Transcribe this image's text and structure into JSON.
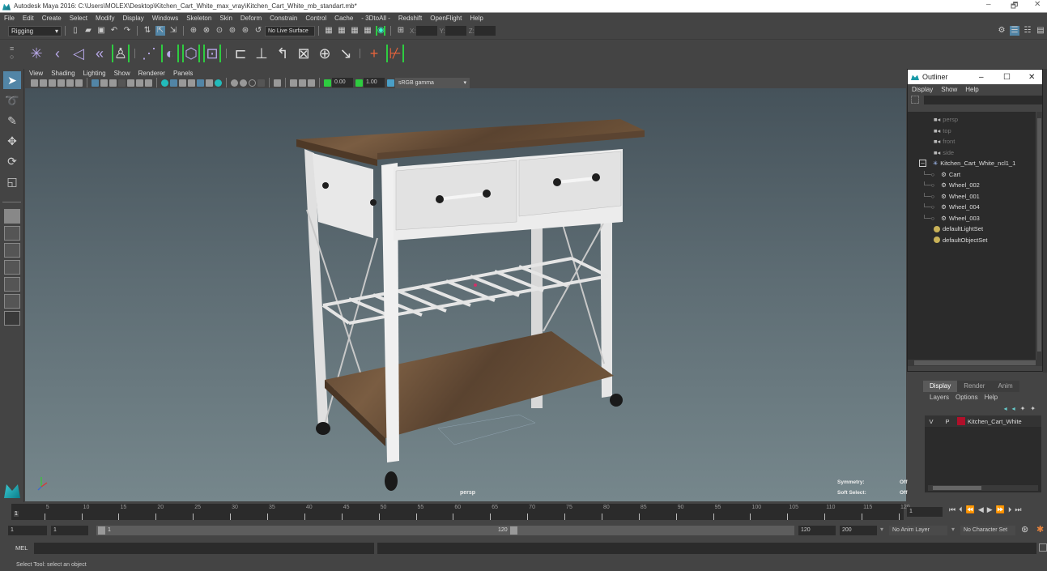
{
  "window": {
    "title": "Autodesk Maya 2016: C:\\Users\\MOLEX\\Desktop\\Kitchen_Cart_White_max_vray\\Kitchen_Cart_White_mb_standart.mb*",
    "minimize": "–",
    "maximize": "🗗",
    "close": "✕"
  },
  "menubar": [
    "File",
    "Edit",
    "Create",
    "Select",
    "Modify",
    "Display",
    "Windows",
    "Skeleton",
    "Skin",
    "Deform",
    "Constrain",
    "Control",
    "Cache",
    "- 3DtoAll -",
    "Redshift",
    "OpenFlight",
    "Help"
  ],
  "status_line": {
    "menu_set": "Rigging",
    "live_surface": "No Live Surface",
    "x_label": "X:",
    "y_label": "Y:",
    "z_label": "Z:",
    "x_value": "",
    "y_value": "",
    "z_value": ""
  },
  "viewport": {
    "menu": [
      "View",
      "Shading",
      "Lighting",
      "Show",
      "Renderer",
      "Panels"
    ],
    "exposure": "0.00",
    "gamma": "1.00",
    "color_space": "sRGB gamma",
    "camera_label": "persp",
    "symmetry_label": "Symmetry:",
    "symmetry_value": "Off",
    "soft_select_label": "Soft Select:",
    "soft_select_value": "Off"
  },
  "outliner": {
    "title": "Outliner",
    "menu": [
      "Display",
      "Show",
      "Help"
    ],
    "items": [
      {
        "label": "persp",
        "type": "camera",
        "indent": 0,
        "dim": true
      },
      {
        "label": "top",
        "type": "camera",
        "indent": 0,
        "dim": true
      },
      {
        "label": "front",
        "type": "camera",
        "indent": 0,
        "dim": true
      },
      {
        "label": "side",
        "type": "camera",
        "indent": 0,
        "dim": true
      },
      {
        "label": "Kitchen_Cart_White_ncl1_1",
        "type": "group",
        "indent": 0,
        "dim": false,
        "expanded": true
      },
      {
        "label": "Cart",
        "type": "mesh",
        "indent": 1,
        "dim": false
      },
      {
        "label": "Wheel_002",
        "type": "mesh",
        "indent": 1,
        "dim": false
      },
      {
        "label": "Wheel_001",
        "type": "mesh",
        "indent": 1,
        "dim": false
      },
      {
        "label": "Wheel_004",
        "type": "mesh",
        "indent": 1,
        "dim": false
      },
      {
        "label": "Wheel_003",
        "type": "mesh",
        "indent": 1,
        "dim": false
      },
      {
        "label": "defaultLightSet",
        "type": "set",
        "indent": 0,
        "dim": false
      },
      {
        "label": "defaultObjectSet",
        "type": "set",
        "indent": 0,
        "dim": false
      }
    ]
  },
  "layer_editor": {
    "tabs": [
      "Display",
      "Render",
      "Anim"
    ],
    "active_tab": "Display",
    "menu": [
      "Layers",
      "Options",
      "Help"
    ],
    "layers": [
      {
        "visible": "V",
        "playback": "P",
        "color": "#b0102a",
        "name": "Kitchen_Cart_White"
      }
    ]
  },
  "timeline": {
    "ticks": [
      "5",
      "10",
      "15",
      "20",
      "25",
      "30",
      "35",
      "40",
      "45",
      "50",
      "55",
      "60",
      "65",
      "70",
      "75",
      "80",
      "85",
      "90",
      "95",
      "100",
      "105",
      "110",
      "115",
      "120"
    ],
    "current_frame_marker": "1",
    "current_frame": "1"
  },
  "range": {
    "start": "1",
    "playback_start": "1",
    "slider_start": "1",
    "slider_end": "120",
    "playback_end": "120",
    "end": "200",
    "anim_layer": "No Anim Layer",
    "character_set": "No Character Set"
  },
  "command_line": {
    "label": "MEL",
    "value": ""
  },
  "status_bar": {
    "message": "Select Tool: select an object"
  }
}
